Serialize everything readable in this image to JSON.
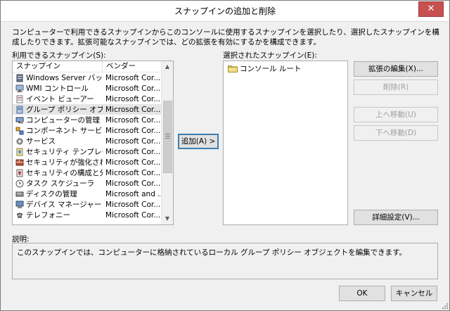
{
  "window": {
    "title": "スナップインの追加と削除",
    "close_label": "✕"
  },
  "description": "コンピューターで利用できるスナップインからこのコンソールに使用するスナップインを選択したり、選択したスナップインを構成したりできます。拡張可能なスナップインでは、どの拡張を有効にするかを構成できます。",
  "available": {
    "label": "利用できるスナップイン(S):",
    "col_snapin": "スナップイン",
    "col_vendor": "ベンダー",
    "items": [
      {
        "name": "Windows Server バッ...",
        "vendor": "Microsoft Cor...",
        "icon": "server-backup-icon"
      },
      {
        "name": "WMI コントロール",
        "vendor": "Microsoft Cor...",
        "icon": "wmi-control-icon"
      },
      {
        "name": "イベント ビューアー",
        "vendor": "Microsoft Cor...",
        "icon": "event-viewer-icon"
      },
      {
        "name": "グループ ポリシー オブジェ...",
        "vendor": "Microsoft Cor...",
        "icon": "group-policy-icon"
      },
      {
        "name": "コンピューターの管理",
        "vendor": "Microsoft Cor...",
        "icon": "computer-management-icon"
      },
      {
        "name": "コンポーネント サービス",
        "vendor": "Microsoft Cor...",
        "icon": "component-services-icon"
      },
      {
        "name": "サービス",
        "vendor": "Microsoft Cor...",
        "icon": "services-gear-icon"
      },
      {
        "name": "セキュリティ テンプレート",
        "vendor": "Microsoft Cor...",
        "icon": "security-template-icon"
      },
      {
        "name": "セキュリティが強化された ...",
        "vendor": "Microsoft Cor...",
        "icon": "firewall-icon"
      },
      {
        "name": "セキュリティの構成と分析",
        "vendor": "Microsoft Cor...",
        "icon": "security-analysis-icon"
      },
      {
        "name": "タスク スケジューラ",
        "vendor": "Microsoft Cor...",
        "icon": "task-scheduler-icon"
      },
      {
        "name": "ディスクの管理",
        "vendor": "Microsoft and ...",
        "icon": "disk-management-icon"
      },
      {
        "name": "デバイス マネージャー",
        "vendor": "Microsoft Cor...",
        "icon": "device-manager-icon"
      },
      {
        "name": "テレフォニー",
        "vendor": "Microsoft Cor...",
        "icon": "telephony-icon"
      }
    ],
    "selected_index": 3
  },
  "add_button": "追加(A) >",
  "selected": {
    "label": "選択されたスナップイン(E):",
    "root_item": "コンソール ルート"
  },
  "buttons": {
    "edit_extensions": "拡張の編集(X)...",
    "remove": "削除(R)",
    "move_up": "上へ移動(U)",
    "move_down": "下へ移動(D)",
    "advanced": "詳細設定(V)...",
    "ok": "OK",
    "cancel": "キャンセル"
  },
  "explanation": {
    "label": "説明:",
    "text": "このスナップインでは、コンピューターに格納されているローカル グループ ポリシー オブジェクトを編集できます。"
  }
}
